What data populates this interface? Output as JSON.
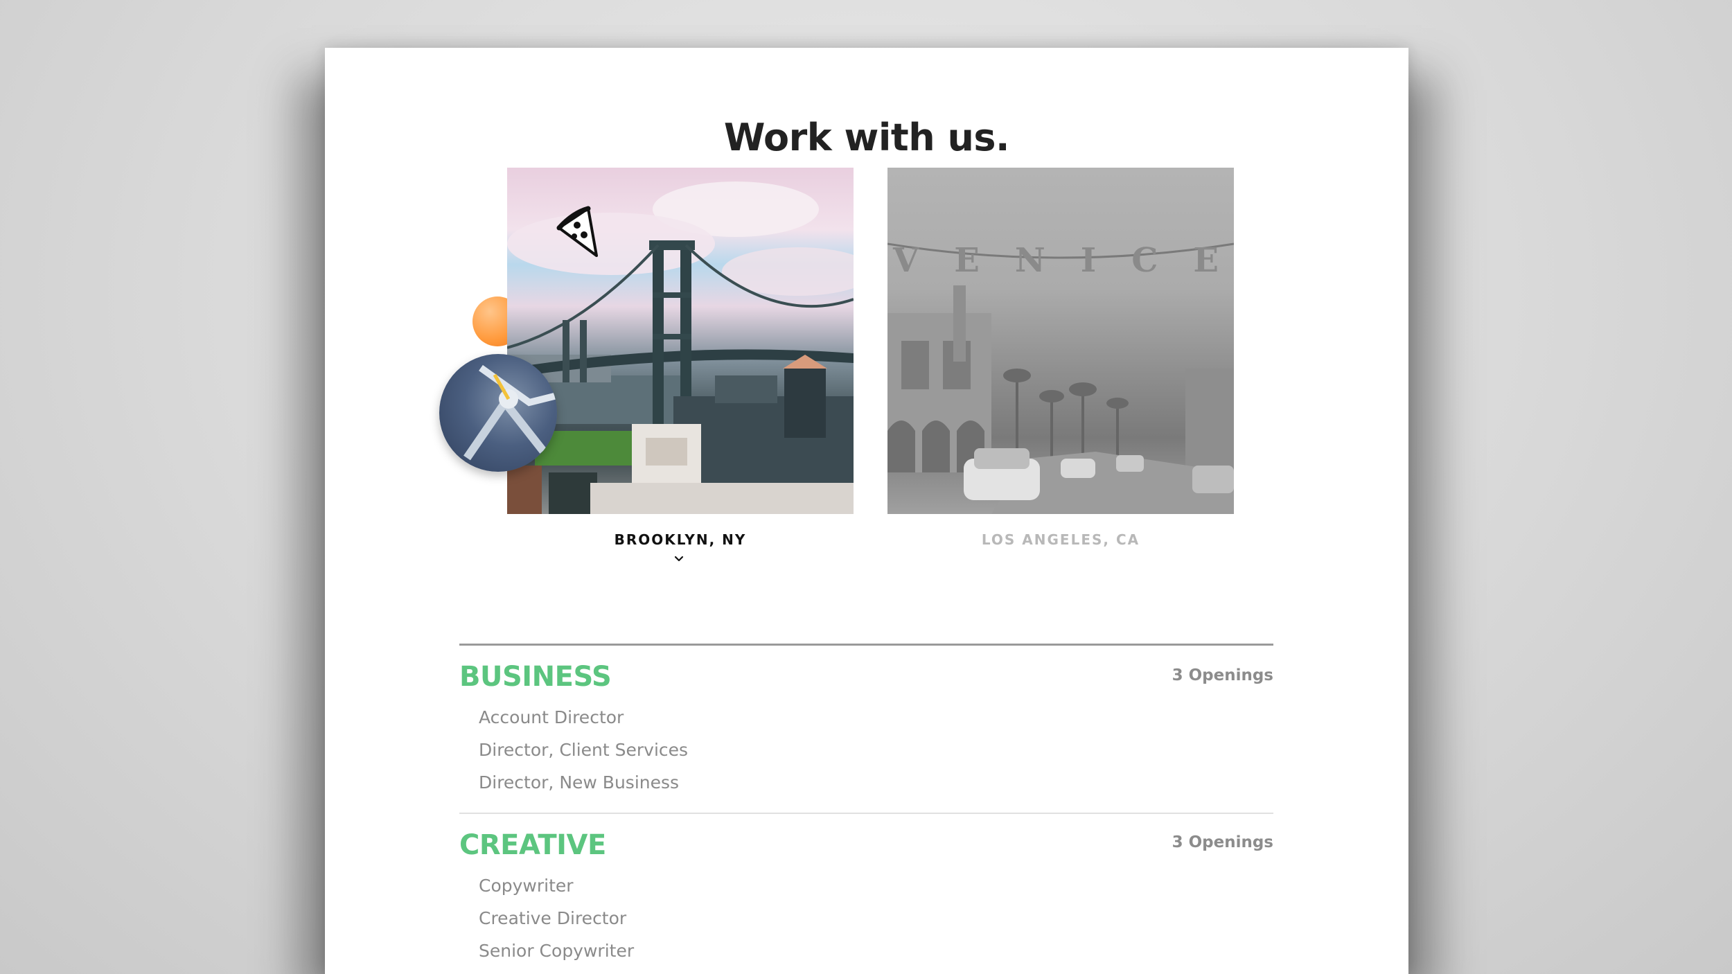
{
  "page": {
    "title": "Work with us."
  },
  "locations": [
    {
      "label": "BROOKLYN, NY",
      "selected": true,
      "photo": "manhattan-bridge-photo"
    },
    {
      "label": "LOS ANGELES, CA",
      "selected": false,
      "photo": "venice-sign-photo"
    }
  ],
  "photo_text": {
    "venice_sign": "VENICE"
  },
  "icons": {
    "selected_indicator": "chevron-down-icon",
    "sticker": "pizza-slice-icon"
  },
  "departments": [
    {
      "name": "BUSINESS",
      "openings": "3 Openings",
      "jobs": [
        "Account Director",
        "Director, Client Services",
        "Director, New Business"
      ]
    },
    {
      "name": "CREATIVE",
      "openings": "3 Openings",
      "jobs": [
        "Copywriter",
        "Creative Director",
        "Senior Copywriter"
      ]
    }
  ],
  "colors": {
    "department_heading": "#5cc57f",
    "job_text": "#8a8a8a",
    "openings_text": "#8c8c8c",
    "active_location": "#111111",
    "inactive_location": "#b8b8b8"
  }
}
